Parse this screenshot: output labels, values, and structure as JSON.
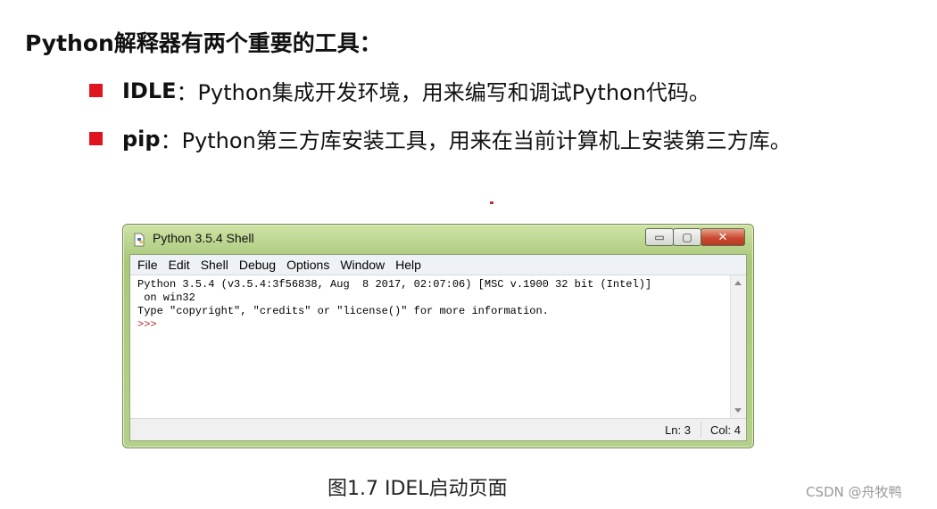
{
  "heading": "Python解释器有两个重要的工具：",
  "bullets": [
    {
      "term": "IDLE",
      "text": "：Python集成开发环境，用来编写和调试Python代码。"
    },
    {
      "term": "pip",
      "text": "：Python第三方库安装工具，用来在当前计算机上安装第三方库。"
    }
  ],
  "window": {
    "title": "Python 3.5.4 Shell",
    "controls": {
      "minimize": "▭",
      "maximize": "▢",
      "close": "✕"
    },
    "menu": [
      "File",
      "Edit",
      "Shell",
      "Debug",
      "Options",
      "Window",
      "Help"
    ],
    "shell_lines": [
      "Python 3.5.4 (v3.5.4:3f56838, Aug  8 2017, 02:07:06) [MSC v.1900 32 bit (Intel)]",
      " on win32",
      "Type \"copyright\", \"credits\" or \"license()\" for more information."
    ],
    "prompt": ">>>",
    "status": {
      "ln": "Ln: 3",
      "col": "Col: 4"
    }
  },
  "caption": "图1.7 IDEL启动页面",
  "watermark": "CSDN @舟牧鸭",
  "colors": {
    "bullet": "#e0141e",
    "prompt": "#b0272e",
    "window_frame": "#a9c87a"
  },
  "icons": {
    "app": "python-file-icon"
  }
}
